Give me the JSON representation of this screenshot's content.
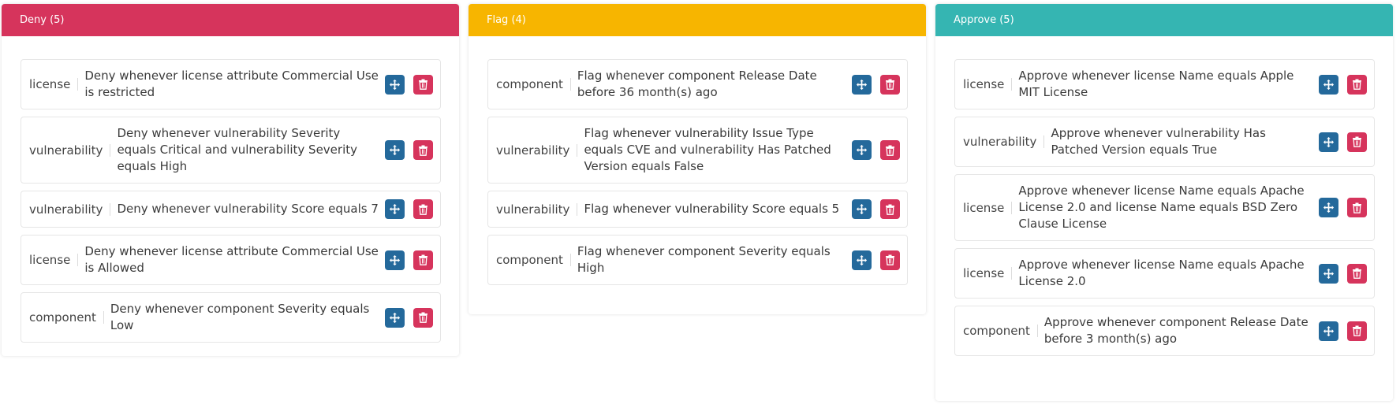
{
  "colors": {
    "deny": "#d6345c",
    "flag": "#f7b500",
    "approve": "#35b5b2",
    "move_button": "#24699b",
    "delete_button": "#d6345c"
  },
  "icons": {
    "move": "move-arrows-icon",
    "delete": "trash-icon"
  },
  "columns": [
    {
      "key": "deny",
      "title": "Deny (5)",
      "rules": [
        {
          "type": "license",
          "text": "Deny whenever license attribute Commercial Use is restricted"
        },
        {
          "type": "vulnerability",
          "text": "Deny whenever vulnerability Severity equals Critical and vulnerability Severity equals High"
        },
        {
          "type": "vulnerability",
          "text": "Deny whenever vulnerability Score equals 7"
        },
        {
          "type": "license",
          "text": "Deny whenever license attribute Commercial Use is Allowed"
        },
        {
          "type": "component",
          "text": "Deny whenever component Severity equals Low"
        }
      ]
    },
    {
      "key": "flag",
      "title": "Flag (4)",
      "rules": [
        {
          "type": "component",
          "text": "Flag whenever component Release Date before 36 month(s) ago"
        },
        {
          "type": "vulnerability",
          "text": "Flag whenever vulnerability Issue Type equals CVE and vulnerability Has Patched Version equals False"
        },
        {
          "type": "vulnerability",
          "text": "Flag whenever vulnerability Score equals 5"
        },
        {
          "type": "component",
          "text": "Flag whenever component Severity equals High"
        }
      ]
    },
    {
      "key": "approve",
      "title": "Approve (5)",
      "rules": [
        {
          "type": "license",
          "text": "Approve whenever license Name equals Apple MIT License"
        },
        {
          "type": "vulnerability",
          "text": "Approve whenever vulnerability Has Patched Version equals True"
        },
        {
          "type": "license",
          "text": "Approve whenever license Name equals Apache License 2.0 and license Name equals BSD Zero Clause License"
        },
        {
          "type": "license",
          "text": "Approve whenever license Name equals Apache License 2.0"
        },
        {
          "type": "component",
          "text": "Approve whenever component Release Date before 3 month(s) ago"
        }
      ]
    }
  ]
}
